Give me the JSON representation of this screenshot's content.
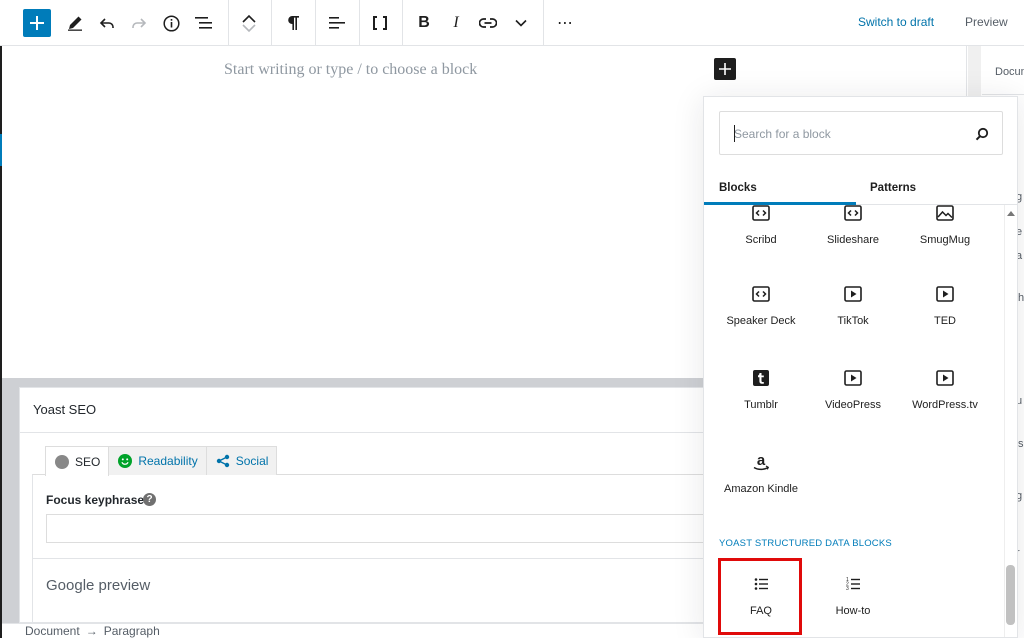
{
  "toolbar": {
    "add_block_icon": "plus-icon",
    "tools_icon": "pencil-icon",
    "undo_icon": "undo-icon",
    "redo_icon": "redo-icon",
    "details_icon": "info-icon",
    "outline_icon": "list-view-icon",
    "move_up_icon": "chevron-up-icon",
    "move_down_icon": "chevron-down-icon",
    "paragraph_icon": "pilcrow-icon",
    "align_icon": "align-left-icon",
    "code_icon": "brackets-icon",
    "bold_label": "B",
    "italic_label": "I",
    "link_icon": "link-icon",
    "more_rich_icon": "chevron-down-icon",
    "more_options_label": "⋯",
    "switch_to_draft": "Switch to draft",
    "preview": "Preview"
  },
  "editor": {
    "placeholder": "Start writing or type / to choose a block"
  },
  "sidebar": {
    "tab_document": "Docum",
    "fragments": [
      "g",
      "e",
      "a",
      "h",
      "u",
      "s",
      "g",
      "r"
    ]
  },
  "inserter": {
    "search_placeholder": "Search for a block",
    "tabs": [
      "Blocks",
      "Patterns"
    ],
    "active_tab": "Blocks",
    "blocks": [
      {
        "label": "Scribd",
        "icon": "embed-icon"
      },
      {
        "label": "Slideshare",
        "icon": "embed-icon"
      },
      {
        "label": "SmugMug",
        "icon": "image-icon"
      },
      {
        "label": "Speaker Deck",
        "icon": "embed-icon"
      },
      {
        "label": "TikTok",
        "icon": "video-icon"
      },
      {
        "label": "TED",
        "icon": "video-icon"
      },
      {
        "label": "Tumblr",
        "icon": "tumblr-icon"
      },
      {
        "label": "VideoPress",
        "icon": "video-icon"
      },
      {
        "label": "WordPress.tv",
        "icon": "video-icon"
      },
      {
        "label": "Amazon Kindle",
        "icon": "amazon-icon"
      }
    ],
    "section_yoast": "YOAST STRUCTURED DATA BLOCKS",
    "yoast_blocks": [
      {
        "label": "FAQ",
        "icon": "list-icon",
        "highlighted": true
      },
      {
        "label": "How-to",
        "icon": "ordered-list-icon",
        "highlighted": false
      }
    ]
  },
  "yoast": {
    "title": "Yoast SEO",
    "tabs": [
      "SEO",
      "Readability",
      "Social"
    ],
    "focus_keyphrase_label": "Focus keyphrase",
    "help_label": "?",
    "focus_keyphrase_value": "",
    "google_preview": "Google preview"
  },
  "footer": {
    "breadcrumb_document": "Document",
    "breadcrumb_separator": "→",
    "breadcrumb_paragraph": "Paragraph"
  },
  "colors": {
    "accent": "#007cba",
    "highlight": "#e00a0a",
    "yoast_green": "#00a32a"
  }
}
